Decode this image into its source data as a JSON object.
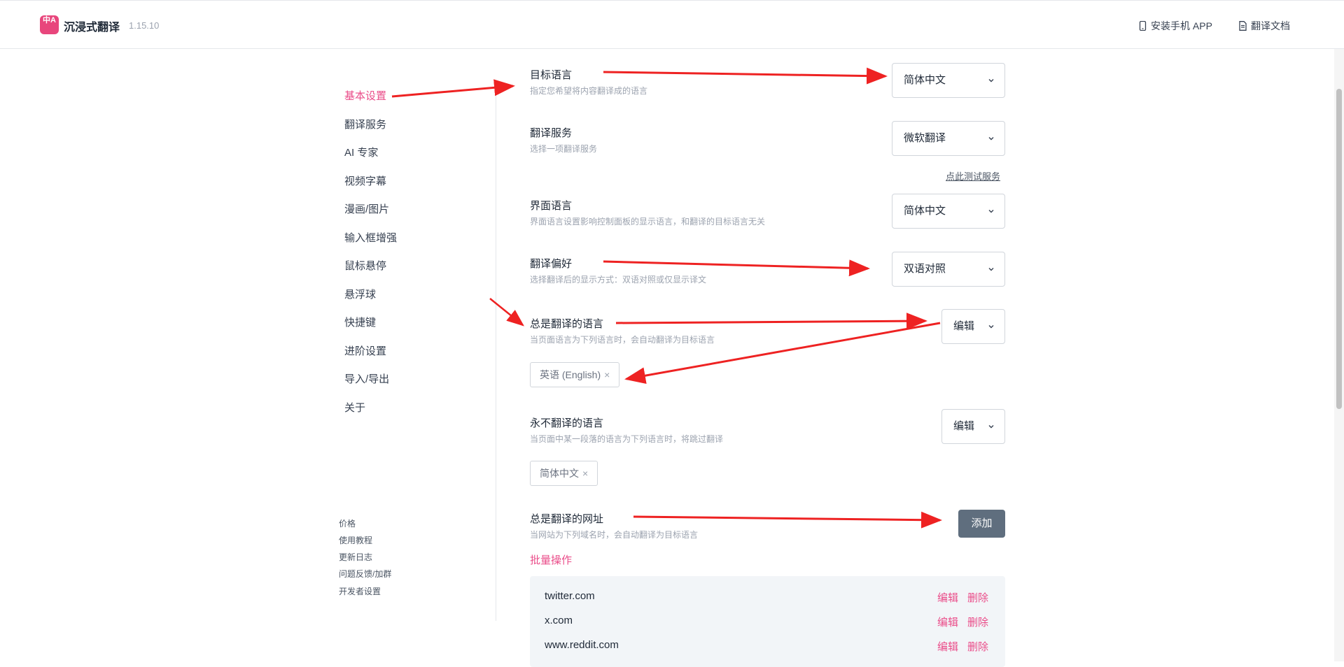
{
  "header": {
    "logo_text": "中A",
    "brand": "沉浸式翻译",
    "version": "1.15.10",
    "links": [
      {
        "label": "安装手机 APP",
        "icon": "phone-icon"
      },
      {
        "label": "翻译文档",
        "icon": "document-icon"
      }
    ]
  },
  "sidebar": {
    "items": [
      {
        "label": "基本设置",
        "active": true
      },
      {
        "label": "翻译服务"
      },
      {
        "label": "AI 专家"
      },
      {
        "label": "视频字幕"
      },
      {
        "label": "漫画/图片"
      },
      {
        "label": "输入框增强"
      },
      {
        "label": "鼠标悬停"
      },
      {
        "label": "悬浮球"
      },
      {
        "label": "快捷键"
      },
      {
        "label": "进阶设置"
      },
      {
        "label": "导入/导出"
      },
      {
        "label": "关于"
      }
    ],
    "footer_links": [
      "价格",
      "使用教程",
      "更新日志",
      "问题反馈/加群",
      "开发者设置"
    ]
  },
  "settings": {
    "target_language": {
      "title": "目标语言",
      "desc": "指定您希望将内容翻译成的语言",
      "value": "简体中文"
    },
    "translation_service": {
      "title": "翻译服务",
      "desc": "选择一项翻译服务",
      "value": "微软翻译",
      "test_link": "点此测试服务"
    },
    "interface_language": {
      "title": "界面语言",
      "desc": "界面语言设置影响控制面板的显示语言，和翻译的目标语言无关",
      "value": "简体中文"
    },
    "translation_preference": {
      "title": "翻译偏好",
      "desc": "选择翻译后的显示方式：双语对照或仅显示译文",
      "value": "双语对照"
    },
    "always_translate_languages": {
      "title": "总是翻译的语言",
      "desc": "当页面语言为下列语言时，会自动翻译为目标语言",
      "button": "编辑",
      "tags": [
        "英语 (English)"
      ]
    },
    "never_translate_languages": {
      "title": "永不翻译的语言",
      "desc": "当页面中某一段落的语言为下列语言时，将跳过翻译",
      "button": "编辑",
      "tags": [
        "简体中文"
      ]
    },
    "always_translate_urls": {
      "title": "总是翻译的网址",
      "desc": "当网站为下列域名时，会自动翻译为目标语言",
      "add_button": "添加",
      "bulk_label": "批量操作",
      "edit_label": "编辑",
      "delete_label": "删除",
      "urls": [
        "twitter.com",
        "x.com",
        "www.reddit.com"
      ]
    }
  },
  "tag_remove_glyph": "×",
  "colors": {
    "accent": "#ea4c89",
    "annotation_arrow": "#ee2222",
    "add_button": "#5f6e7e"
  }
}
